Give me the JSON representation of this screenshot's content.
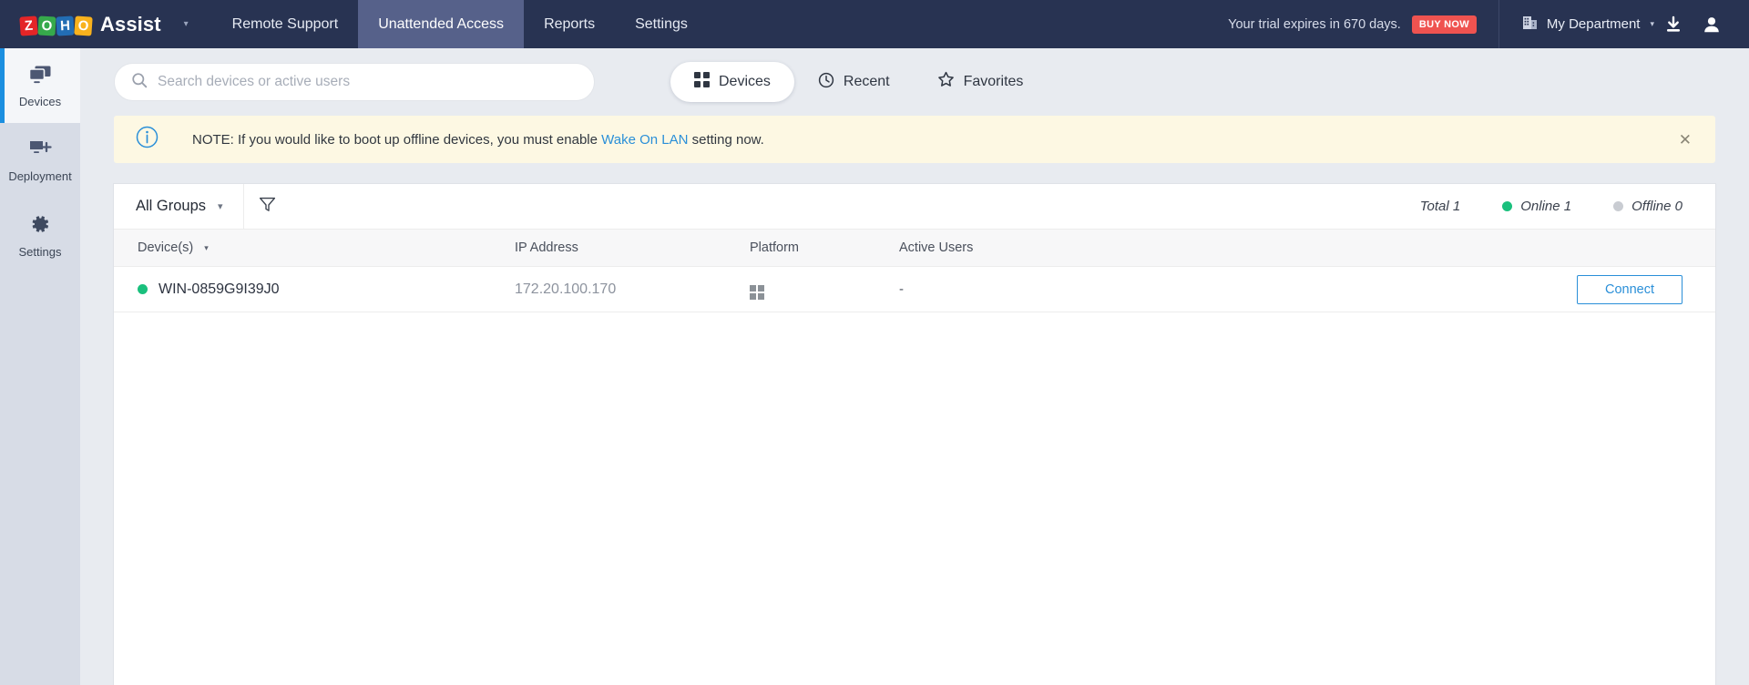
{
  "topnav": {
    "brand": {
      "logo_letters": [
        "Z",
        "O",
        "H",
        "O"
      ],
      "product": "Assist",
      "caret": "▾"
    },
    "tabs": [
      {
        "label": "Remote Support",
        "active": false
      },
      {
        "label": "Unattended Access",
        "active": true
      },
      {
        "label": "Reports",
        "active": false
      },
      {
        "label": "Settings",
        "active": false
      }
    ],
    "trial_text": "Your trial expires in 670 days.",
    "buy_now_label": "BUY NOW",
    "department": "My Department",
    "department_caret": "▾",
    "download_icon": "download-icon",
    "profile_icon": "user-icon"
  },
  "sidebar": {
    "items": [
      {
        "label": "Devices",
        "icon": "monitors-icon",
        "active": true
      },
      {
        "label": "Deployment",
        "icon": "monitor-plus-icon",
        "active": false
      },
      {
        "label": "Settings",
        "icon": "gear-icon",
        "active": false
      }
    ]
  },
  "search": {
    "placeholder": "Search devices or active users",
    "value": "",
    "icon": "search-icon"
  },
  "view_tabs": [
    {
      "label": "Devices",
      "icon": "grid-icon",
      "active": true
    },
    {
      "label": "Recent",
      "icon": "clock-icon",
      "active": false
    },
    {
      "label": "Favorites",
      "icon": "star-icon",
      "active": false
    }
  ],
  "notice": {
    "icon": "info-icon",
    "text_before": "NOTE: If you would like to boot up offline devices, you must enable ",
    "link_text": "Wake On LAN",
    "text_after": " setting now.",
    "close_icon": "close-icon"
  },
  "panel": {
    "group_selector": {
      "label": "All Groups",
      "caret": "▾"
    },
    "filter_icon": "filter-icon",
    "stats": {
      "total": "Total 1",
      "online": "Online 1",
      "offline": "Offline 0"
    }
  },
  "table": {
    "columns": [
      {
        "label": "Device(s)",
        "sort": "▾"
      },
      {
        "label": "IP Address"
      },
      {
        "label": "Platform"
      },
      {
        "label": "Active Users"
      }
    ],
    "rows": [
      {
        "status": "online",
        "device": "WIN-0859G9I39J0",
        "ip": "172.20.100.170",
        "platform_icon": "windows-icon",
        "active_users": "-",
        "action_label": "Connect"
      }
    ]
  },
  "colors": {
    "topnav_bg": "#283352",
    "topnav_active": "#56618a",
    "accent_blue": "#2a8fd8",
    "sidebar_bg": "#d7dce6",
    "sidebar_active_bar": "#1b8fe0",
    "page_bg": "#e8ebf0",
    "notice_bg": "#fdf8e3",
    "buy_now_bg": "#ef5350",
    "online_green": "#1ac07d",
    "offline_gray": "#c9ccd2"
  }
}
